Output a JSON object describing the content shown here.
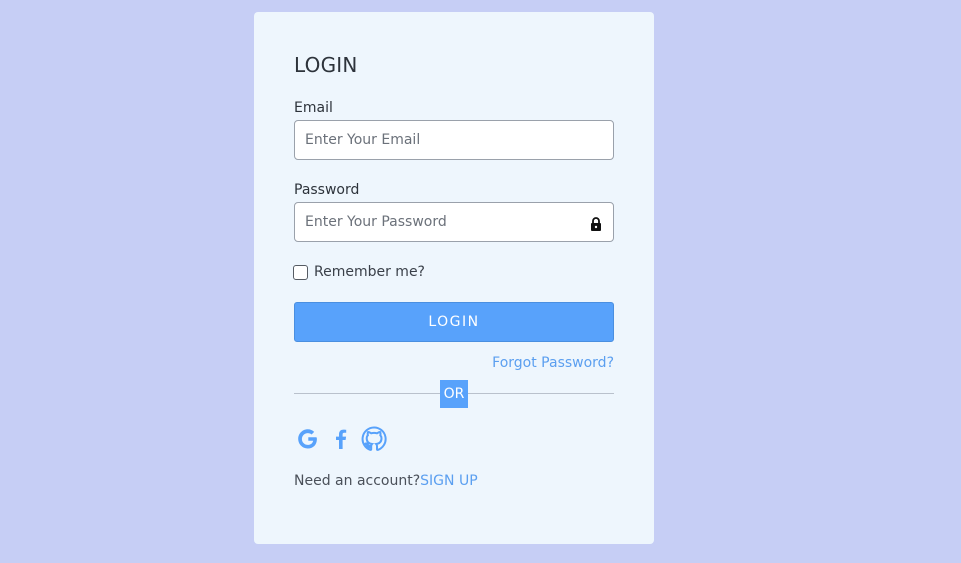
{
  "login": {
    "title": "LOGIN",
    "email": {
      "label": "Email",
      "placeholder": "Enter Your Email",
      "value": ""
    },
    "password": {
      "label": "Password",
      "placeholder": "Enter Your Password",
      "value": "",
      "icon": "lock-icon"
    },
    "remember": {
      "label": "Remember me?",
      "checked": false
    },
    "submit_label": "LOGIN",
    "forgot_label": "Forgot Password?",
    "divider_label": "OR",
    "social": [
      {
        "icon": "google-icon"
      },
      {
        "icon": "facebook-icon"
      },
      {
        "icon": "github-icon"
      }
    ],
    "signup": {
      "prompt": "Need an account?",
      "link_label": "SIGN UP"
    }
  },
  "colors": {
    "background": "#c6cef5",
    "card": "#eef6fd",
    "accent": "#58a2fb",
    "link": "#5b9ff0"
  }
}
